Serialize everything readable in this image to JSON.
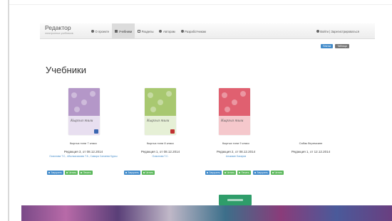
{
  "app": {
    "brand": "Редактор",
    "brand_sub": "электронных учебников"
  },
  "nav": {
    "items": [
      {
        "label": "О проекте",
        "icon": "info-icon"
      },
      {
        "label": "Учебники",
        "icon": "book-icon",
        "active": true
      },
      {
        "label": "Разделы",
        "icon": "file-icon"
      },
      {
        "label": "Авторам",
        "icon": "user-icon"
      },
      {
        "label": "Разработчикам",
        "icon": "gear-icon"
      }
    ],
    "login": "Войти | Зарегистрироваться"
  },
  "view_toggles": [
    "Плитка",
    "Таблица"
  ],
  "page_title": "Учебники",
  "books": [
    {
      "name": "Кыргыз тили 7 класс",
      "edition": "Редакция 3, от 08.12.2014",
      "authors": "Осмонова Т.С., Абылкасымова Т.К., Самара Салаева Нурсы",
      "buttons": [
        "Загрузить",
        "Читать",
        "Печать"
      ],
      "cover_top_color": "#b497c8",
      "cover_bottom_color": "#e8dff0",
      "badge_color": "#3a66b0"
    },
    {
      "name": "Кыргыз тили 8 класс",
      "edition": "Редакция 1, от 08.12.2014",
      "authors": "Осмонова Т.С.",
      "buttons": [
        "Загрузить",
        "Читать"
      ],
      "cover_top_color": "#a8c870",
      "cover_bottom_color": "#e6f0d6",
      "badge_color": "#c03030"
    },
    {
      "name": "Кыргыз тили 9 класс",
      "edition": "Редакция 2, от 08.12.2014",
      "authors": "Алымкан Бакиров",
      "buttons": [
        "Загрузить",
        "Читать",
        "Печать"
      ],
      "cover_top_color": "#e06070",
      "cover_bottom_color": "#f5c8cc",
      "badge_color": ""
    },
    {
      "name": "Сабак беремсине",
      "edition": "Редакция 1, от 12.12.2014",
      "authors": "",
      "buttons": [
        "Загрузить",
        "Читать"
      ],
      "cover_top_color": "",
      "cover_bottom_color": "",
      "badge_color": ""
    }
  ],
  "cover_label": "Кыргыз тили",
  "colors": {
    "primary": "#428bca",
    "success": "#5cb85c",
    "navbar": "#f0f0f0"
  }
}
